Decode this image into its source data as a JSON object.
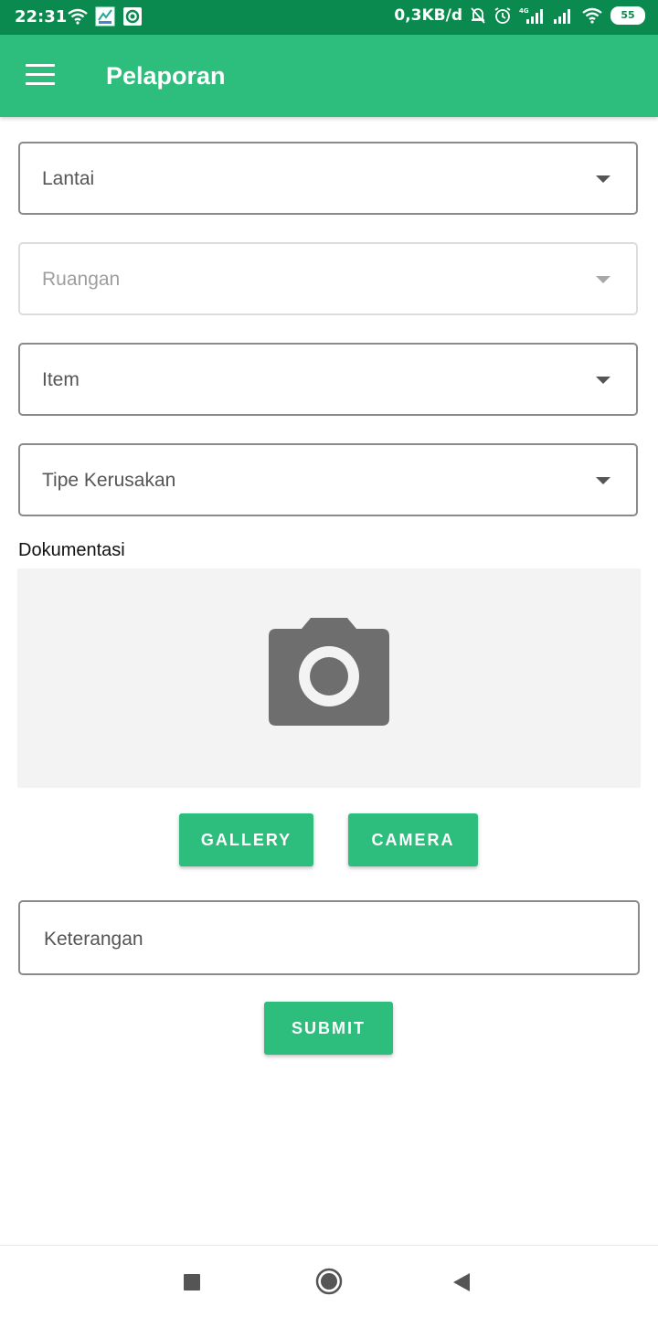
{
  "status_bar": {
    "time": "22:31",
    "net_speed": "0,3KB/d",
    "battery": "55",
    "icons": [
      "wifi-icon",
      "app-notification-icon",
      "app-notification-icon-2",
      "mute-bell-icon",
      "alarm-icon",
      "signal-4g-icon",
      "signal-icon",
      "wifi-icon",
      "battery-icon"
    ]
  },
  "appbar": {
    "title": "Pelaporan",
    "menu_icon": "hamburger-menu-icon",
    "color": "#2dbd7c"
  },
  "form": {
    "lantai": {
      "label": "Lantai"
    },
    "ruangan": {
      "label": "Ruangan",
      "disabled": true
    },
    "item": {
      "label": "Item"
    },
    "tipe": {
      "label": "Tipe Kerusakan"
    },
    "dokumentasi": {
      "label": "Dokumentasi",
      "placeholder_icon": "camera-icon"
    },
    "gallery_button": "GALLERY",
    "camera_button": "CAMERA",
    "keterangan": {
      "placeholder": "Keterangan"
    },
    "submit_button": "SUBMIT"
  },
  "nav_bar": {
    "icons": [
      "recent-apps-icon",
      "home-icon",
      "back-icon"
    ]
  }
}
